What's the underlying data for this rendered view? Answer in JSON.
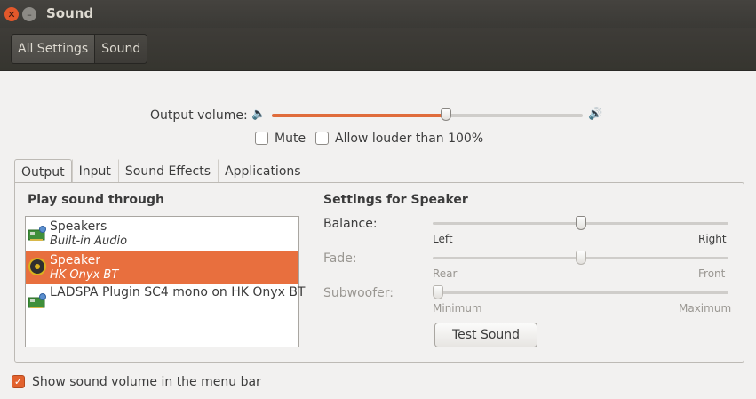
{
  "window": {
    "title": "Sound"
  },
  "toolbar": {
    "crumbs": [
      "All Settings",
      "Sound"
    ]
  },
  "volume": {
    "label": "Output volume:",
    "level": 0.56
  },
  "options": {
    "mute": "Mute",
    "mute_checked": false,
    "louder": "Allow louder than 100%",
    "louder_checked": false
  },
  "tabs": [
    "Output",
    "Input",
    "Sound Effects",
    "Applications"
  ],
  "output": {
    "list_title": "Play sound through",
    "devices": [
      {
        "name": "Speakers",
        "sub": "Built-in Audio",
        "icon": "sound-card-icon"
      },
      {
        "name": "Speaker",
        "sub": "HK Onyx BT",
        "icon": "speaker-icon",
        "selected": true
      },
      {
        "name": "LADSPA Plugin SC4 mono on HK Onyx BT",
        "sub": "",
        "icon": "sound-card-icon"
      }
    ],
    "settings_title": "Settings for Speaker",
    "balance": {
      "label": "Balance:",
      "left": "Left",
      "right": "Right",
      "value": 0.5
    },
    "fade": {
      "label": "Fade:",
      "left": "Rear",
      "right": "Front",
      "value": 0.5
    },
    "subwoofer": {
      "label": "Subwoofer:",
      "left": "Minimum",
      "right": "Maximum",
      "value": 0.0
    },
    "test_button": "Test Sound"
  },
  "footer": {
    "menu_bar_label": "Show sound volume in the menu bar",
    "menu_bar_checked": true
  },
  "colors": {
    "accent": "#e86f3e",
    "titlebar": "#3c3b37"
  }
}
